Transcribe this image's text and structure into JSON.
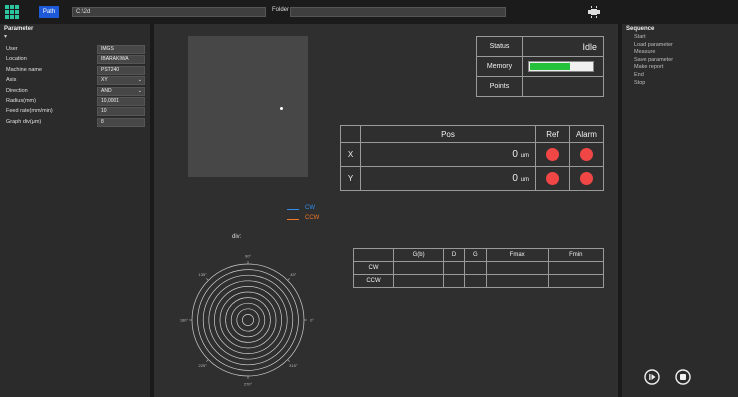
{
  "toolbar": {
    "path_button_label": "Path",
    "path_value": "C:\\2d",
    "folder_label": "Folder",
    "folder_value": ""
  },
  "parameter": {
    "title": "Parameter",
    "caret": "▾",
    "rows": [
      {
        "label": "User",
        "value": "IMGS",
        "dropdown": false
      },
      {
        "label": "Location",
        "value": "IBARAKIWA",
        "dropdown": false
      },
      {
        "label": "Machine name",
        "value": "PST240",
        "dropdown": false
      },
      {
        "label": "Axis",
        "value": "XY",
        "dropdown": true
      },
      {
        "label": "Direction",
        "value": "AND",
        "dropdown": true
      },
      {
        "label": "Radius(mm)",
        "value": "10,0001",
        "dropdown": false
      },
      {
        "label": "Feed rate(mm/min)",
        "value": "10",
        "dropdown": false
      },
      {
        "label": "Graph div(μm)",
        "value": "8",
        "dropdown": false
      }
    ]
  },
  "status": {
    "status_label": "Status",
    "status_value": "Idle",
    "memory_label": "Memory",
    "memory_fraction": 0.62,
    "points_label": "Points",
    "points_value": ""
  },
  "position": {
    "pos_header": "Pos",
    "ref_header": "Ref",
    "alarm_header": "Alarm",
    "rows": [
      {
        "axis": "X",
        "value": "0",
        "unit": "um"
      },
      {
        "axis": "Y",
        "value": "0",
        "unit": "um"
      }
    ],
    "led_color": "#f04646"
  },
  "results": {
    "headers": [
      "G(b)",
      "D",
      "G",
      "Fmax",
      "Fmin"
    ],
    "rows": [
      {
        "label": "CW",
        "values": [
          "",
          "",
          "",
          "",
          ""
        ]
      },
      {
        "label": "CCW",
        "values": [
          "",
          "",
          "",
          "",
          ""
        ]
      }
    ]
  },
  "plot": {
    "div_label": "div:",
    "legend": [
      {
        "name": "CW",
        "color": "#2f8ff0"
      },
      {
        "name": "CCW",
        "color": "#f07a28"
      }
    ],
    "angle_labels": [
      "90°",
      "45°",
      "0°",
      "315°",
      "270°",
      "225°",
      "180°",
      "135°"
    ],
    "ring_count": 10
  },
  "sequence": {
    "title": "Sequence",
    "items": [
      "Start",
      "Load parameter",
      "Measure",
      "Save parameter",
      "Make report",
      "End",
      "Stop"
    ]
  },
  "colors": {
    "accent": "#1e5ad8",
    "memory_fill": "#23c23a"
  }
}
